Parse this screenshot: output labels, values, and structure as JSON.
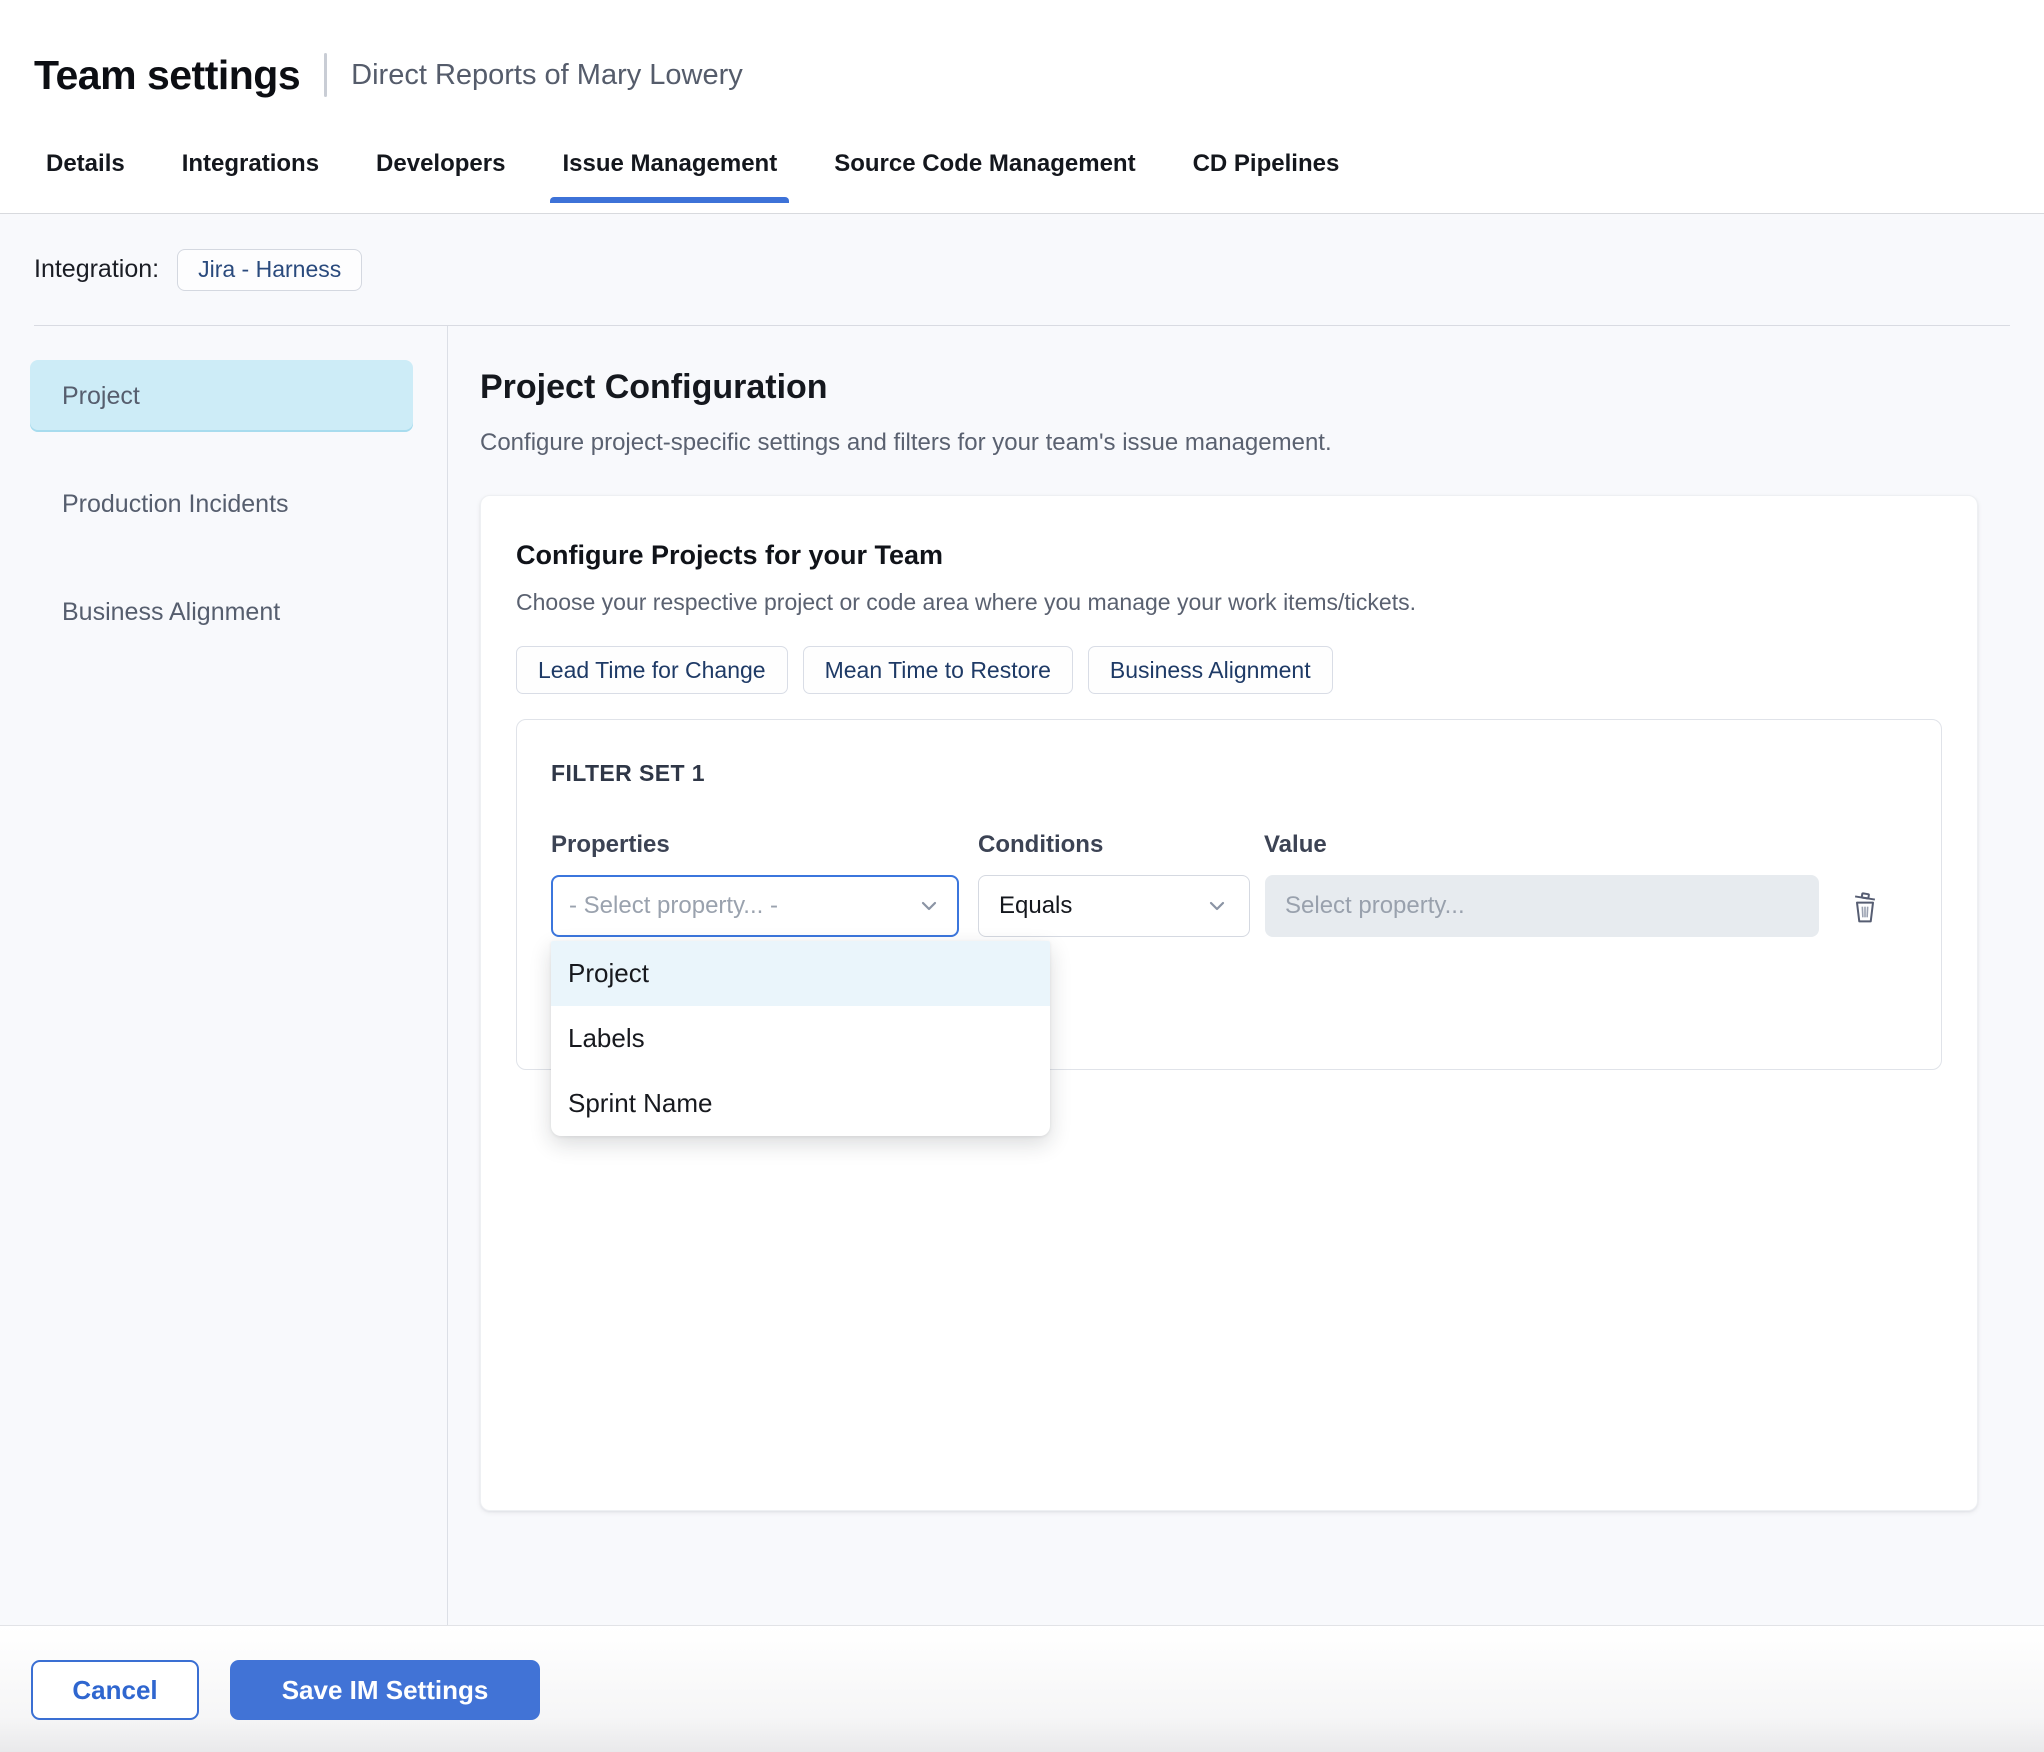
{
  "header": {
    "title": "Team settings",
    "subtitle": "Direct Reports of Mary Lowery"
  },
  "tabs": [
    {
      "label": "Details",
      "active": false
    },
    {
      "label": "Integrations",
      "active": false
    },
    {
      "label": "Developers",
      "active": false
    },
    {
      "label": "Issue Management",
      "active": true
    },
    {
      "label": "Source Code Management",
      "active": false
    },
    {
      "label": "CD Pipelines",
      "active": false
    }
  ],
  "integration": {
    "label": "Integration:",
    "chip": "Jira - Harness"
  },
  "sidebar": {
    "items": [
      {
        "label": "Project",
        "active": true
      },
      {
        "label": "Production Incidents",
        "active": false
      },
      {
        "label": "Business Alignment",
        "active": false
      }
    ]
  },
  "main": {
    "heading": "Project Configuration",
    "description": "Configure project-specific settings and filters for your team's issue management.",
    "card": {
      "title": "Configure Projects for your Team",
      "subtitle": "Choose your respective project or code area where you manage your work items/tickets.",
      "metric_tabs": [
        "Lead Time for Change",
        "Mean Time to Restore",
        "Business Alignment"
      ],
      "filter_set": {
        "title": "FILTER SET 1",
        "columns": {
          "properties": "Properties",
          "conditions": "Conditions",
          "value": "Value"
        },
        "property_placeholder": "- Select property... -",
        "condition_selected": "Equals",
        "value_placeholder": "Select property...",
        "dropdown_options": [
          {
            "label": "Project",
            "highlighted": true
          },
          {
            "label": "Labels",
            "highlighted": false
          },
          {
            "label": "Sprint Name",
            "highlighted": false
          }
        ]
      }
    }
  },
  "footer": {
    "cancel_label": "Cancel",
    "save_label": "Save IM Settings"
  },
  "colors": {
    "accent_blue": "#3d72d8",
    "focus_border": "#3b76dd",
    "selected_sidebar_bg": "#cdecf7",
    "dropdown_highlight_bg": "#eaf5fb",
    "chip_text": "#1e3a66",
    "save_button_bg": "#4173d6",
    "content_bg": "#f8f9fc"
  }
}
